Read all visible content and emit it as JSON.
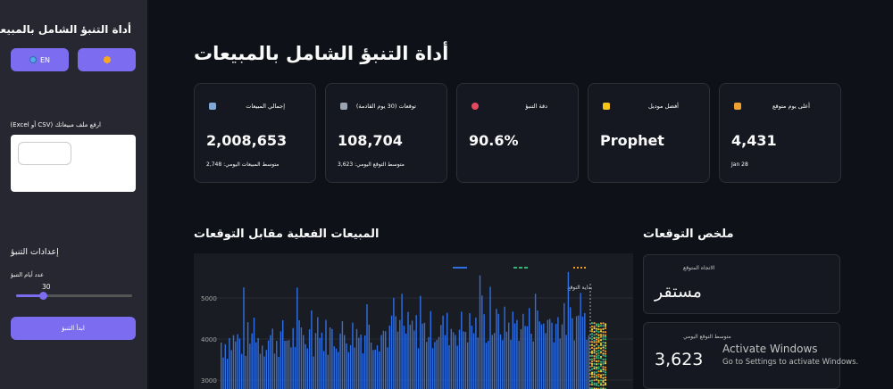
{
  "sidebar": {
    "title": "أداة التنبؤ الشامل بالمبيعات",
    "lang_en_label": "EN",
    "upload_label": "ارفع ملف مبيعاتك (CSV أو Excel)",
    "settings_title": "إعدادات التنبؤ",
    "days_label": "عدد أيام التنبؤ",
    "days_value": "30",
    "days_fraction": 0.2,
    "start_label": "ابدأ التنبؤ"
  },
  "main": {
    "title": "أداة التنبؤ الشامل بالمبيعات",
    "cards": [
      {
        "icon": "calendar-icon",
        "label": "إجمالي المبيعات",
        "value": "2,008,653",
        "sub": "متوسط المبيعات اليومي: 2,748"
      },
      {
        "icon": "chart-up-icon",
        "label": "توقعات (30 يوم القادمة)",
        "value": "108,704",
        "sub": "متوسط التوقع اليومي: 3,623"
      },
      {
        "icon": "target-icon",
        "label": "دقة التنبؤ",
        "value": "90.6%",
        "sub": ""
      },
      {
        "icon": "star-icon",
        "label": "أفضل موديل",
        "value": "Prophet",
        "sub": ""
      },
      {
        "icon": "trophy-icon",
        "label": "أعلى يوم متوقع",
        "value": "4,431",
        "sub": "Jan 28"
      }
    ],
    "chart_title": "المبيعات الفعلية مقابل التوقعات",
    "summary_title": "ملخص التوقعات",
    "summary": [
      {
        "label": "الاتجاه المتوقع",
        "value": "مستقر"
      },
      {
        "label": "متوسط التوقع اليومي",
        "value": "3,623"
      }
    ]
  },
  "chart_data": {
    "type": "bar",
    "yticks": [
      "5000",
      "4000",
      "3000"
    ],
    "annotation": "بداية التوقع",
    "colors": {
      "actual": "#2f6fe4",
      "forecast_green": "#2fb57a",
      "forecast_orange": "#f59b23"
    }
  },
  "watermark": {
    "line1": "Activate Windows",
    "line2": "Go to Settings to activate Windows."
  }
}
